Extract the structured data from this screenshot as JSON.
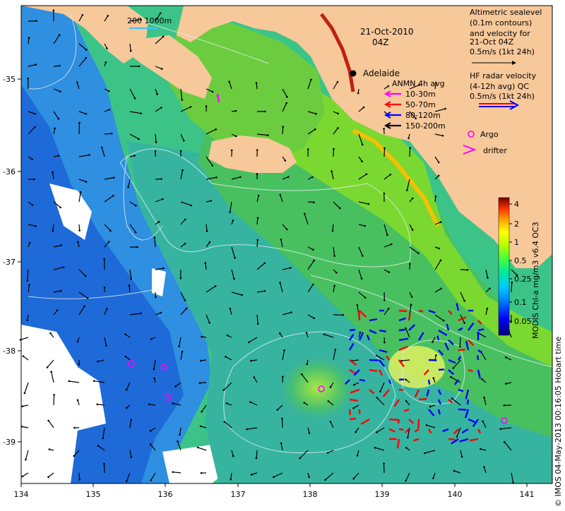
{
  "header": {
    "date": "21-Oct-2010",
    "time": "04Z"
  },
  "scale_bar": {
    "label": "200  1000m"
  },
  "place": {
    "name": "Adelaide"
  },
  "legend_right": {
    "altimetry_lines": [
      "Altimetric sealevel",
      "(0.1m contours)",
      "and velocity for",
      "21-Oct 04Z",
      "0.5m/s (1kt 24h)"
    ],
    "hf_lines": [
      "HF radar velocity",
      "(4-12h avg) QC",
      "0.5m/s (1kt 24h)"
    ]
  },
  "anmn_legend": {
    "title": "ANMN 4h avg",
    "items": [
      {
        "label": "10-30m",
        "color": "#ff00ff"
      },
      {
        "label": "50-70m",
        "color": "#ff0000"
      },
      {
        "label": "80-120m",
        "color": "#0000ff"
      },
      {
        "label": "150-200m",
        "color": "#000000"
      }
    ]
  },
  "markers_legend": [
    {
      "label": "Argo",
      "symbol": "circle",
      "color": "#ff00ff"
    },
    {
      "label": "drifter",
      "symbol": "chevron",
      "color": "#ff00ff"
    }
  ],
  "colorbar": {
    "title": "MODIS Chl-a mg/m3 v6.4 OC3",
    "ticks": [
      "4",
      "2",
      "1",
      "0.5",
      "0.25",
      "0.1",
      "0.05"
    ],
    "colors": [
      "#00007a",
      "#0000ff",
      "#0080ff",
      "#00c8ff",
      "#00ffc0",
      "#40ff40",
      "#a0ff00",
      "#ffff00",
      "#ffb000",
      "#ff5000",
      "#c00000",
      "#700000"
    ]
  },
  "axes": {
    "x_ticks": [
      "134",
      "135",
      "136",
      "137",
      "138",
      "139",
      "140",
      "141"
    ],
    "y_ticks": [
      "-35",
      "-36",
      "-37",
      "-38",
      "-39"
    ]
  },
  "credit": "© IMOS 04-May-2013 00:16:05 Hobart time",
  "colors": {
    "land": "#f7c89a",
    "ocean_low": "#2e8ce8",
    "ocean_mid": "#30c8a8",
    "ocean_high": "#3cc830"
  }
}
